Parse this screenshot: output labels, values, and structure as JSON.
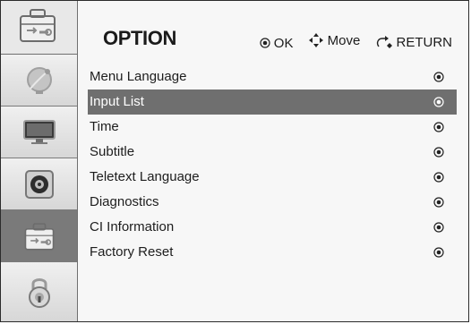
{
  "header": {
    "title": "OPTION",
    "hints": [
      {
        "icon": "ok-icon",
        "label": "OK"
      },
      {
        "icon": "move-icon",
        "label": "Move"
      },
      {
        "icon": "return-icon",
        "label": "RETURN"
      }
    ]
  },
  "sidebar": {
    "items": [
      {
        "icon": "satellite-dish-icon",
        "active": false
      },
      {
        "icon": "monitor-icon",
        "active": false
      },
      {
        "icon": "speaker-icon",
        "active": false
      },
      {
        "icon": "option-toolbox-icon",
        "active": true
      },
      {
        "icon": "lock-icon",
        "active": false
      }
    ]
  },
  "menu": {
    "items": [
      {
        "label": "Menu Language",
        "selected": false
      },
      {
        "label": "Input List",
        "selected": true
      },
      {
        "label": "Time",
        "selected": false
      },
      {
        "label": "Subtitle",
        "selected": false
      },
      {
        "label": "Teletext Language",
        "selected": false
      },
      {
        "label": "Diagnostics",
        "selected": false
      },
      {
        "label": "CI Information",
        "selected": false
      },
      {
        "label": "Factory Reset",
        "selected": false
      }
    ]
  },
  "colors": {
    "selected_bg": "#6f6f6f",
    "active_sidebar_bg": "#7a7a7a",
    "text": "#1d1d1d"
  }
}
